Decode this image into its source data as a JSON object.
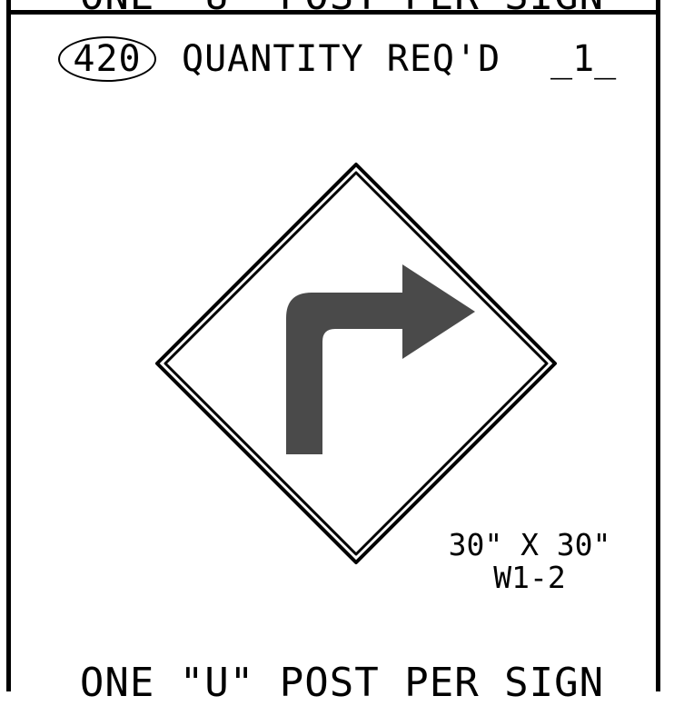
{
  "sheet": {
    "top_note_partial": "ONE \"U\" POST PER SIGN",
    "item_number": "420",
    "quantity_label": "QUANTITY REQ'D",
    "quantity_value": "_1_",
    "sign_size": "30\" X 30\"",
    "sign_code": "W1-2",
    "bottom_note": "ONE \"U\" POST PER SIGN"
  },
  "colors": {
    "line": "#000000",
    "arrow": "#4a4a4a",
    "background": "#ffffff"
  },
  "icons": {
    "sign": "right-turn-warning-sign-icon"
  }
}
